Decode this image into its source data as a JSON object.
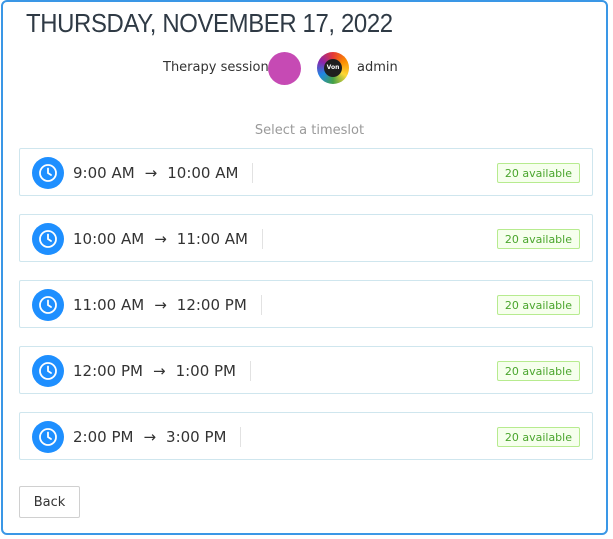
{
  "header": {
    "date": "THURSDAY, NOVEMBER 17, 2022"
  },
  "meta": {
    "session_label": "Therapy session",
    "session_color": "#c64ab4",
    "admin_avatar_text": "Von",
    "admin_label": "admin"
  },
  "prompt": "Select a timeslot",
  "slots": [
    {
      "start": "9:00 AM",
      "end": "10:00 AM",
      "availability": "20 available"
    },
    {
      "start": "10:00 AM",
      "end": "11:00 AM",
      "availability": "20 available"
    },
    {
      "start": "11:00 AM",
      "end": "12:00 PM",
      "availability": "20 available"
    },
    {
      "start": "12:00 PM",
      "end": "1:00 PM",
      "availability": "20 available"
    },
    {
      "start": "2:00 PM",
      "end": "3:00 PM",
      "availability": "20 available"
    }
  ],
  "arrow_glyph": "→",
  "icons": {
    "slot_icon": "clock-icon"
  },
  "colors": {
    "accent": "#1e8fff",
    "available_text": "#4aa52d",
    "border": "#3a97e6"
  },
  "actions": {
    "back_label": "Back"
  }
}
